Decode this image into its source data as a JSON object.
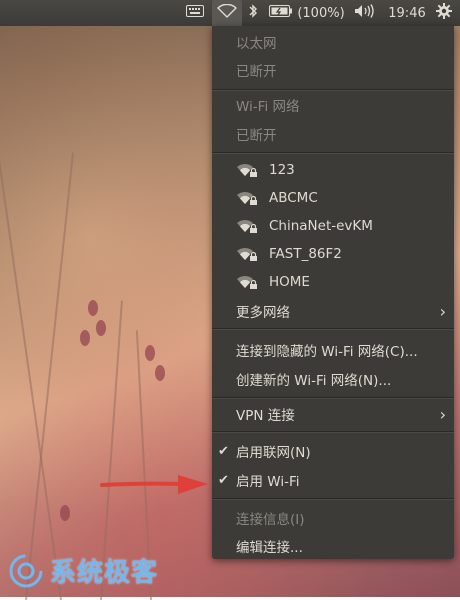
{
  "panel": {
    "battery_text": "(100%)",
    "clock": "19:46",
    "icons": [
      "keyboard-icon",
      "wifi-icon",
      "bluetooth-icon",
      "battery-icon",
      "volume-icon",
      "gear-icon"
    ]
  },
  "menu": {
    "ethernet_header": "以太网",
    "ethernet_status": "已断开",
    "wifi_header": "Wi-Fi 网络",
    "wifi_status": "已断开",
    "networks": [
      "123",
      "ABCMC",
      "ChinaNet-evKM",
      "FAST_86F2",
      "HOME"
    ],
    "more_networks": "更多网络",
    "connect_hidden": "连接到隐藏的 Wi-Fi 网络(C)...",
    "create_new": "创建新的 Wi-Fi 网络(N)...",
    "vpn": "VPN 连接",
    "enable_networking": "启用联网(N)",
    "enable_wifi": "启用 Wi-Fi",
    "connection_info": "连接信息(I)",
    "edit_connections": "编辑连接..."
  },
  "watermark": {
    "text": "系统极客"
  },
  "colors": {
    "panel": "#3c3b37",
    "menu_text": "#dfdbd2",
    "disabled_text": "#8a8780",
    "arrow": "#e0403a",
    "watermark": "#6fb8f0"
  }
}
